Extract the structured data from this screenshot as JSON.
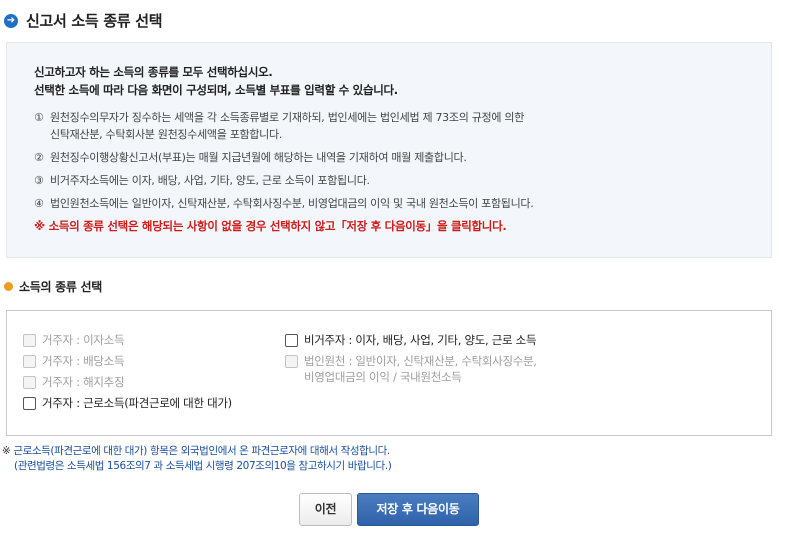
{
  "page": {
    "title": "신고서 소득 종류 선택",
    "title_icon": "arrow-right-circle-icon"
  },
  "notice": {
    "lead_line1": "신고하고자 하는 소득의 종류를 모두 선택하십시오.",
    "lead_line2": "선택한 소득에 따라 다음 화면이 구성되며, 소득별 부표를 입력할 수 있습니다.",
    "items": [
      {
        "num": "①",
        "text": "원천징수의무자가 징수하는 세액을 각 소득종류별로 기재하되, 법인세에는 법인세법 제 73조의 규정에 의한\n신탁재산분, 수탁회사분 원천징수세액을 포함합니다."
      },
      {
        "num": "②",
        "text": "원천징수이행상황신고서(부표)는 매월 지급년월에 해당하는 내역을 기재하여 매월 제출합니다."
      },
      {
        "num": "③",
        "text": "비거주자소득에는 이자, 배당, 사업, 기타, 양도, 근로 소득이 포함됩니다."
      },
      {
        "num": "④",
        "text": "법인원천소득에는 일반이자, 신탁재산분, 수탁회사징수분, 비영업대금의 이익 및 국내 원천소득이 포함됩니다."
      }
    ],
    "warning": "※ 소득의 종류 선택은 해당되는 사항이 없을 경우 선택하지 않고「저장 후 다음이동」을 클릭합니다.",
    "warning_color": "#d01b1b"
  },
  "section": {
    "title": "소득의 종류 선택",
    "icon": "orange-dot-icon"
  },
  "options": {
    "left": [
      {
        "label": "거주자 : 이자소득",
        "enabled": false,
        "checked": false
      },
      {
        "label": "거주자 : 배당소득",
        "enabled": false,
        "checked": false
      },
      {
        "label": "거주자 : 해지추징",
        "enabled": false,
        "checked": false
      },
      {
        "label": "거주자 : 근로소득(파견근로에 대한 대가)",
        "enabled": true,
        "checked": false
      }
    ],
    "right": [
      {
        "label": "비거주자 : 이자, 배당, 사업, 기타, 양도, 근로 소득",
        "enabled": true,
        "checked": false
      },
      {
        "label": "법인원천 : 일반이자, 신탁재산분, 수탁회사징수분,\n                  비영업대금의 이익 / 국내원천소득",
        "enabled": false,
        "checked": false
      }
    ]
  },
  "footnote": {
    "symbol": "※",
    "line1": "근로소득(파견근로에 대한 대가) 항목은 외국법인에서 온 파견근로자에 대해서 작성합니다.",
    "line2": "(관련법령은 소득세법 156조의7 과 소득세법 시행령 207조의10을 참고하시기 바랍니다.)",
    "color": "#1a4fa0"
  },
  "buttons": {
    "prev": "이전",
    "next": "저장 후 다음이동",
    "next_color": "#2f62a8"
  }
}
